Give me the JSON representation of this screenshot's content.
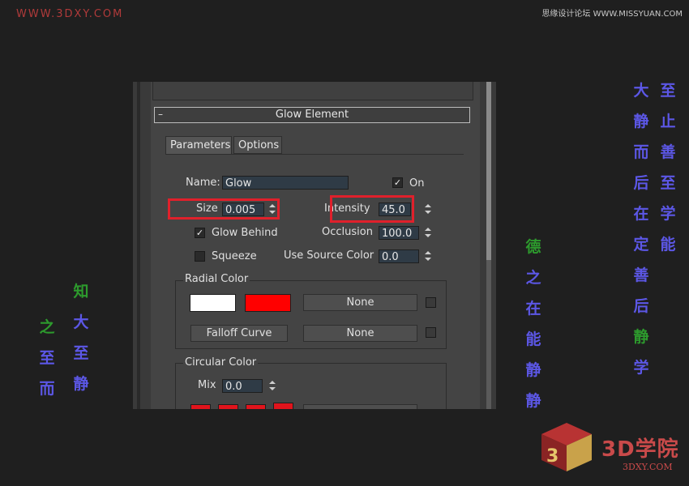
{
  "watermarks": {
    "top_left": "WWW.3DXY.COM",
    "top_right": "思缘设计论坛 WWW.MISSYUAN.COM",
    "bottom_right_brand": "3D学院",
    "bottom_right_url": "3DXY.COM"
  },
  "rollout": {
    "title": "Glow Element"
  },
  "tabs": [
    {
      "label": "Parameters",
      "active": true
    },
    {
      "label": "Options",
      "active": false
    }
  ],
  "params": {
    "name_label": "Name:",
    "name_value": "Glow",
    "on_label": "On",
    "on_checked": true,
    "size_label": "Size",
    "size_value": "0.005",
    "intensity_label": "Intensity",
    "intensity_value": "45.0",
    "glow_behind_label": "Glow Behind",
    "glow_behind_checked": true,
    "occlusion_label": "Occlusion",
    "occlusion_value": "100.0",
    "squeeze_label": "Squeeze",
    "squeeze_checked": false,
    "use_source_color_label": "Use Source Color",
    "use_source_color_value": "0.0"
  },
  "radial_color": {
    "title": "Radial Color",
    "color1": "#ffffff",
    "color2": "#ff0000",
    "none_label_1": "None",
    "falloff_curve_label": "Falloff Curve",
    "none_label_2": "None"
  },
  "circular_color": {
    "title": "Circular Color",
    "mix_label": "Mix",
    "mix_value": "0.0",
    "swatch_color": "#e0141c"
  },
  "highlight_color": "#e0202b",
  "decorative_text": {
    "left_col_1": [
      "之",
      "至",
      "而"
    ],
    "left_col_2": [
      "知",
      "大",
      "至",
      "静"
    ],
    "mid_col": [
      "德",
      "之",
      "在",
      "能",
      "静",
      "静"
    ],
    "right_col_1": [
      "大",
      "静",
      "而",
      "后",
      "在",
      "定",
      "善",
      "后",
      "静",
      "学"
    ],
    "right_col_2": [
      "至",
      "止",
      "善",
      "至",
      "学",
      "能"
    ]
  }
}
